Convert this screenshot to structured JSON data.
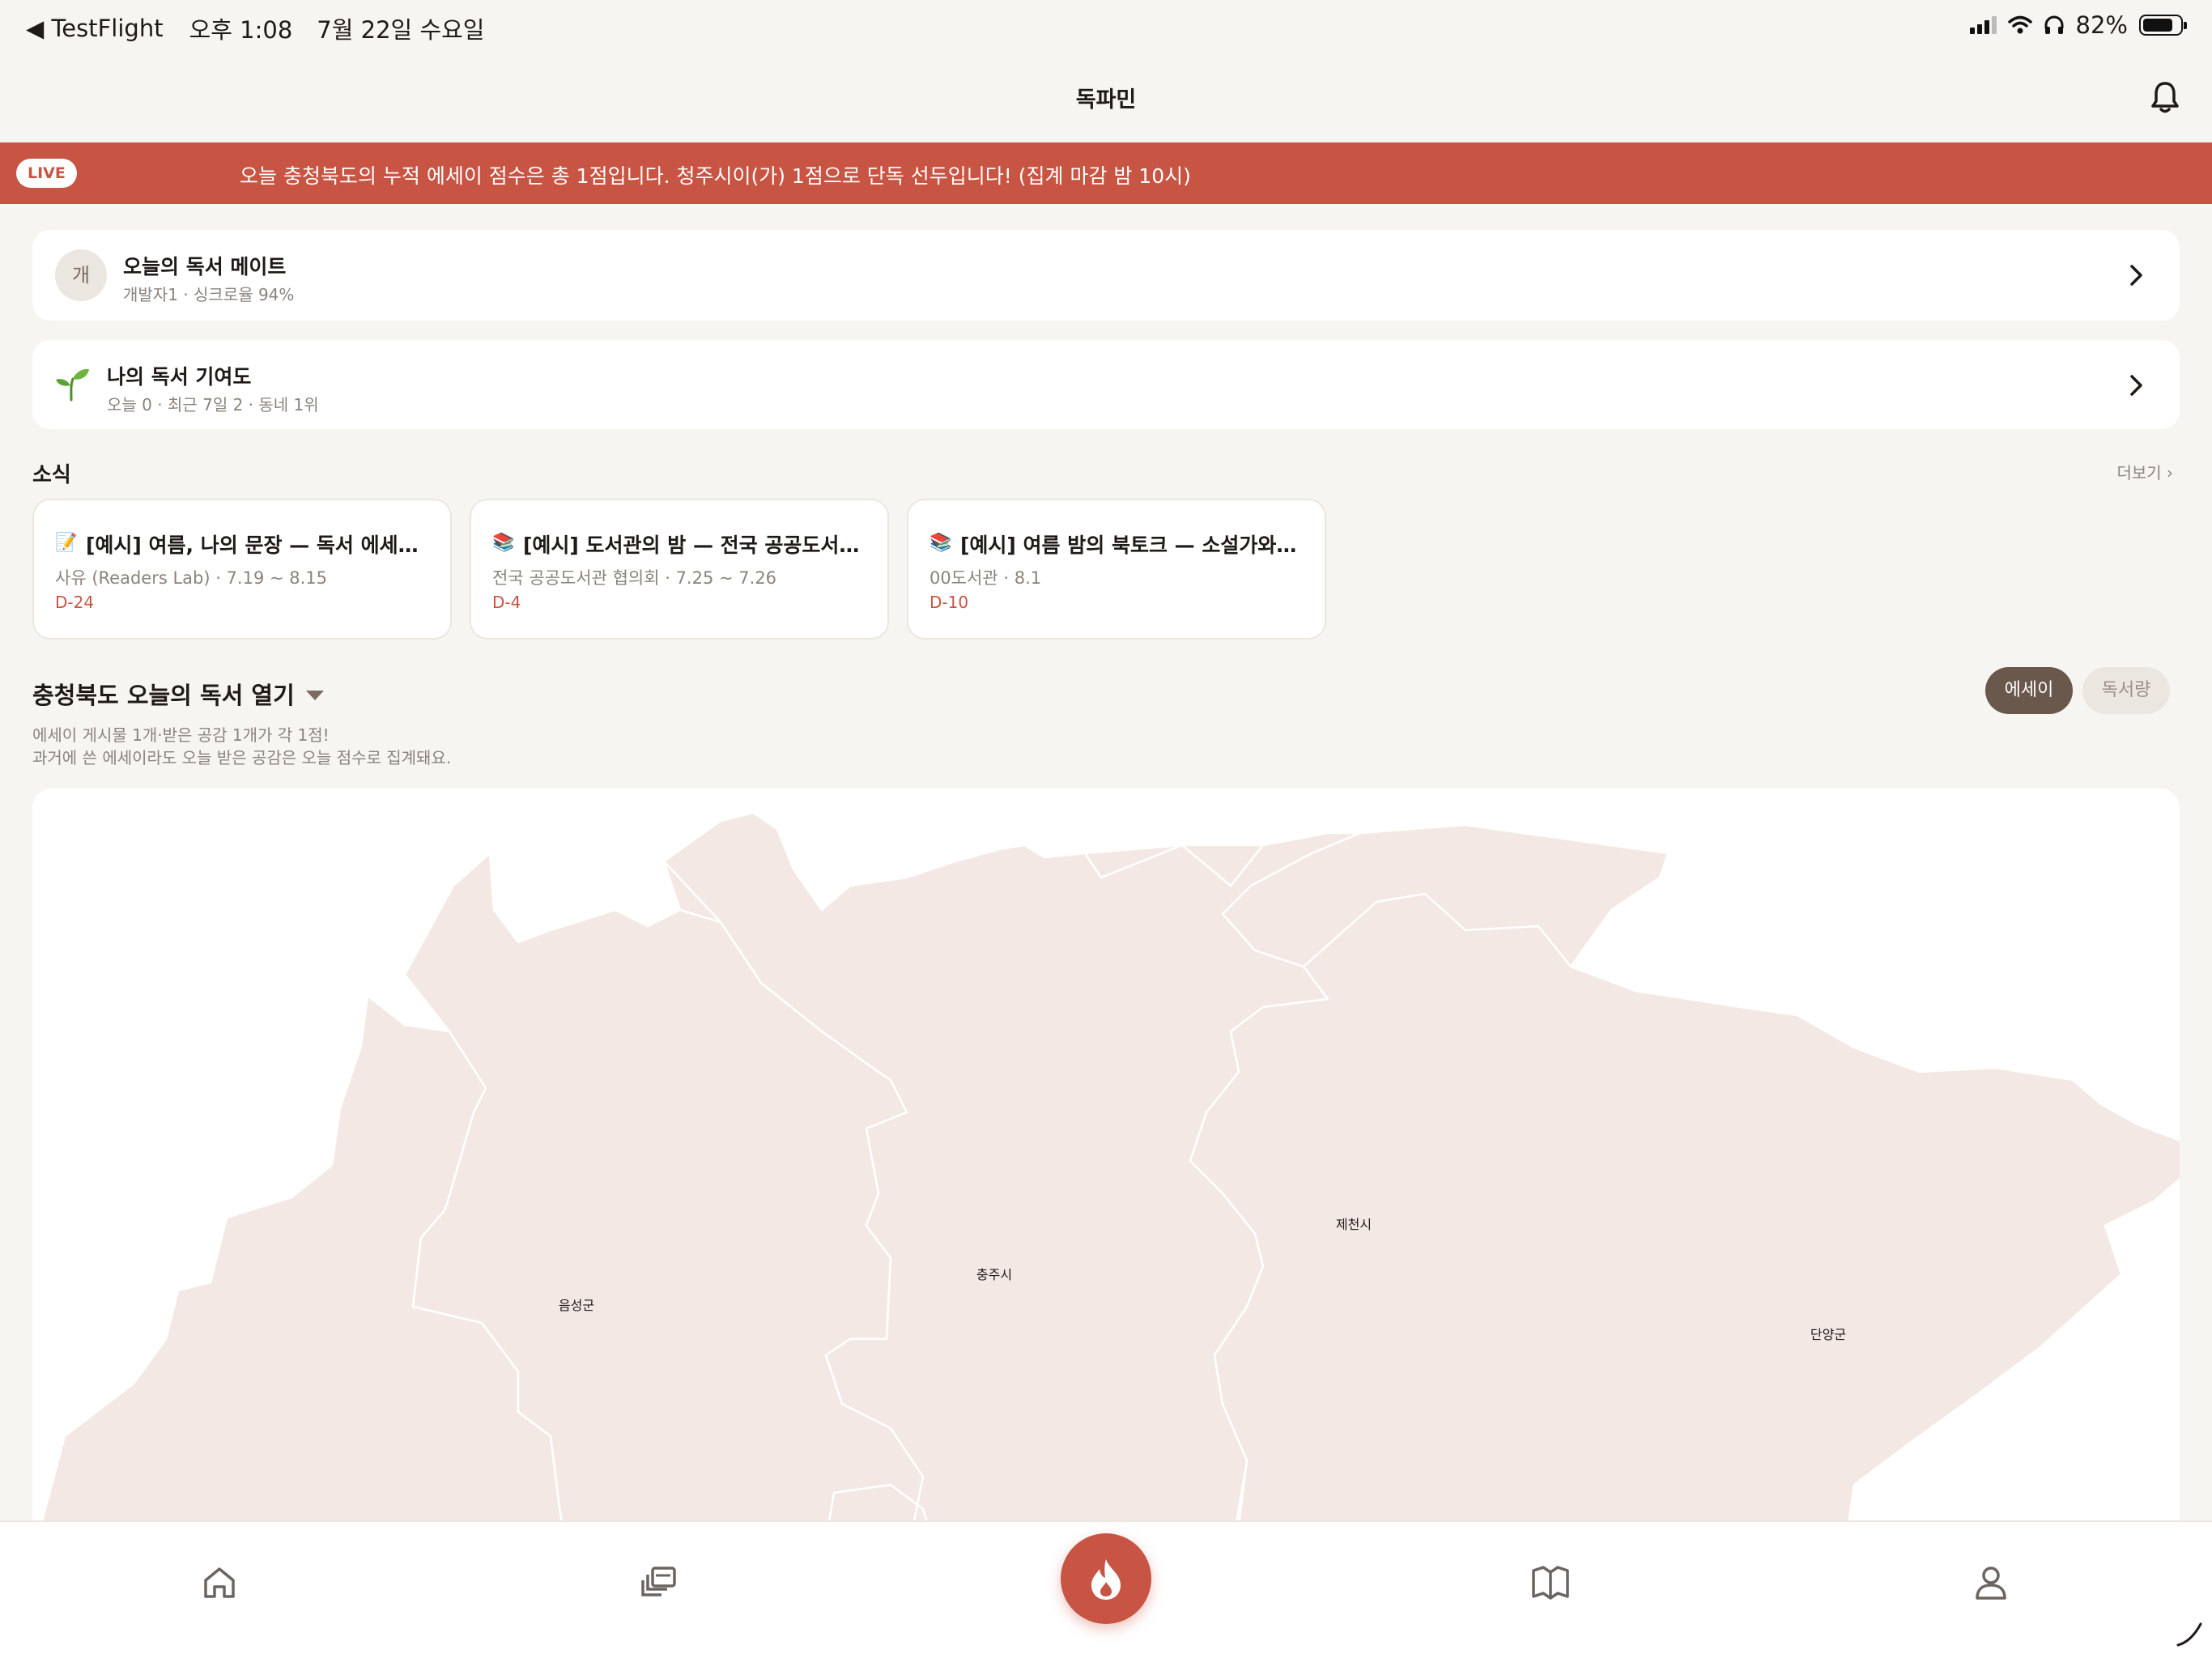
{
  "status_bar": {
    "back_label": "◀ TestFlight",
    "time": "오후 1:08",
    "date": "7월 22일 수요일",
    "battery_percent": "82%",
    "battery_level": 0.82
  },
  "header": {
    "title": "독파민"
  },
  "live": {
    "badge": "LIVE",
    "text": "오늘 충청북도의 누적 에세이 점수은 총 1점입니다. 청주시이(가) 1점으로 단독 선두입니다! (집계 마감 밤 10시)"
  },
  "mate_card": {
    "avatar": "개",
    "title": "오늘의 독서 메이트",
    "subtitle": "개발자1 · 싱크로율 94%"
  },
  "contrib_card": {
    "icon": "sprout-icon",
    "title": "나의 독서 기여도",
    "subtitle": "오늘 0 · 최근 7일 2 · 동네 1위"
  },
  "news": {
    "title": "소식",
    "more": "더보기 ›",
    "items": [
      {
        "icon": "📝",
        "title": "[예시] 여름, 나의 문장 — 독서 에세이 대회",
        "meta": "사유 (Readers Lab) · 7.19 ~ 8.15",
        "dday": "D-24"
      },
      {
        "icon": "📚",
        "title": "[예시] 도서관의 밤 — 전국 공공도서관 …",
        "meta": "전국 공공도서관 협의회 · 7.25 ~ 7.26",
        "dday": "D-4"
      },
      {
        "icon": "📚",
        "title": "[예시] 여름 밤의 북토크 — 소설가와의 …",
        "meta": "00도서관 · 8.1",
        "dday": "D-10"
      }
    ]
  },
  "heat": {
    "title": "충청북도 오늘의 독서 열기",
    "desc_line1": "에세이 게시물 1개·받은 공감 1개가 각 1점!",
    "desc_line2": "과거에 쓴 에세이라도 오늘 받은 공감은 오늘 점수로 집계돼요.",
    "toggle_essay": "에세이",
    "toggle_amount": "독서량",
    "selected": "에세이"
  },
  "map": {
    "fill_color": "#f3e8e4",
    "stroke_color": "#ffffff",
    "regions": [
      {
        "name": "음성군"
      },
      {
        "name": "충주시"
      },
      {
        "name": "제천시"
      },
      {
        "name": "단양군"
      }
    ]
  },
  "tabbar": {
    "items": [
      "home-icon",
      "feed-icon",
      "fire-icon",
      "book-icon",
      "profile-icon"
    ],
    "active": "fire-icon"
  },
  "colors": {
    "accent": "#c85443",
    "brown": "#6b584d",
    "background": "#f7f5f2"
  }
}
